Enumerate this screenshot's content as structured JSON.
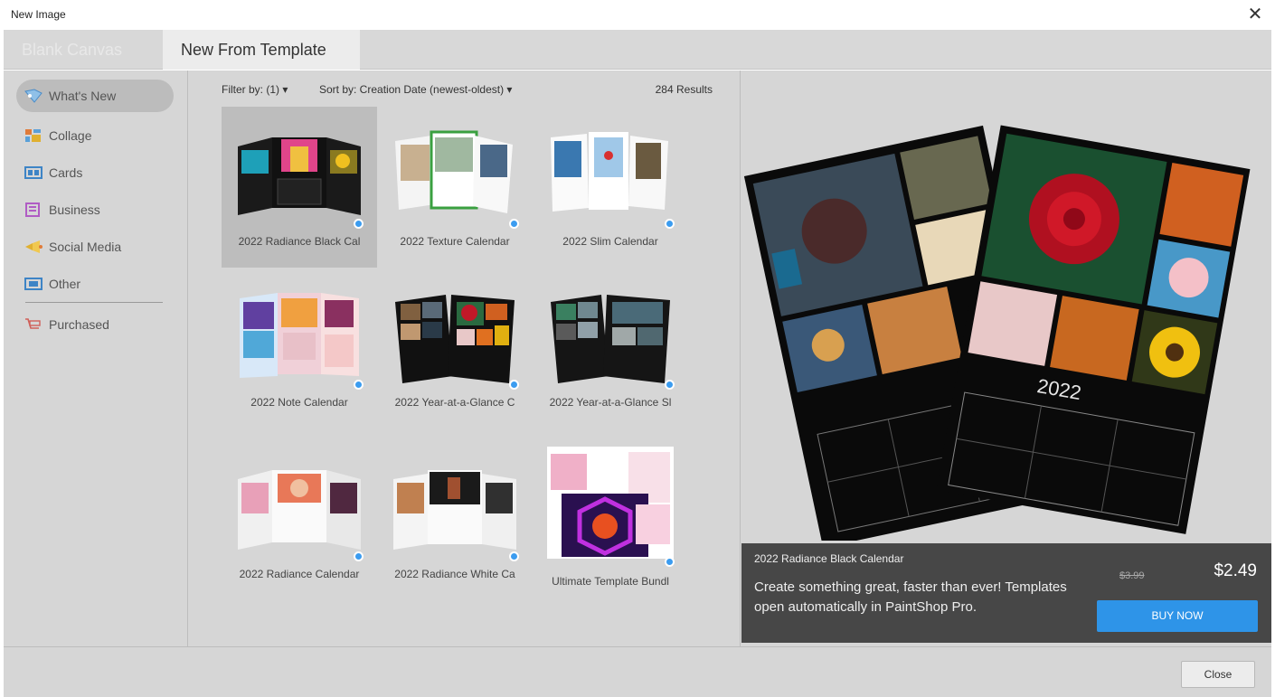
{
  "window": {
    "title": "New Image",
    "close_glyph": "✕"
  },
  "tabs": [
    {
      "label": "Blank Canvas"
    },
    {
      "label": "New From Template"
    }
  ],
  "sidebar": {
    "items": [
      {
        "label": "What's New",
        "icon": "whats-new-icon"
      },
      {
        "label": "Collage",
        "icon": "collage-icon"
      },
      {
        "label": "Cards",
        "icon": "cards-icon"
      },
      {
        "label": "Business",
        "icon": "business-icon"
      },
      {
        "label": "Social Media",
        "icon": "social-media-icon"
      },
      {
        "label": "Other",
        "icon": "other-icon"
      },
      {
        "label": "Purchased",
        "icon": "purchased-icon"
      }
    ]
  },
  "toolbar": {
    "filter": "Filter by: (1) ▾",
    "sort": "Sort by: Creation Date (newest-oldest) ▾",
    "results": "284 Results"
  },
  "templates": [
    {
      "name": "2022 Radiance Black Cal"
    },
    {
      "name": "2022 Texture Calendar"
    },
    {
      "name": "2022 Slim Calendar"
    },
    {
      "name": "2022 Note Calendar"
    },
    {
      "name": "2022 Year-at-a-Glance C"
    },
    {
      "name": "2022 Year-at-a-Glance Sl"
    },
    {
      "name": "2022 Radiance Calendar"
    },
    {
      "name": "2022 Radiance White Ca"
    },
    {
      "name": "Ultimate Template Bundl"
    }
  ],
  "preview": {
    "year_label": "2022",
    "title": "2022 Radiance Black Calendar",
    "description": "Create something great, faster than ever! Templates open automatically in PaintShop Pro.",
    "old_price": "$3.99",
    "price": "$2.49",
    "buy_label": "BUY NOW"
  },
  "footer": {
    "close_label": "Close"
  },
  "colors": {
    "accent": "#2e94e8",
    "panel_dark": "#474747",
    "bg": "#d6d6d6"
  }
}
